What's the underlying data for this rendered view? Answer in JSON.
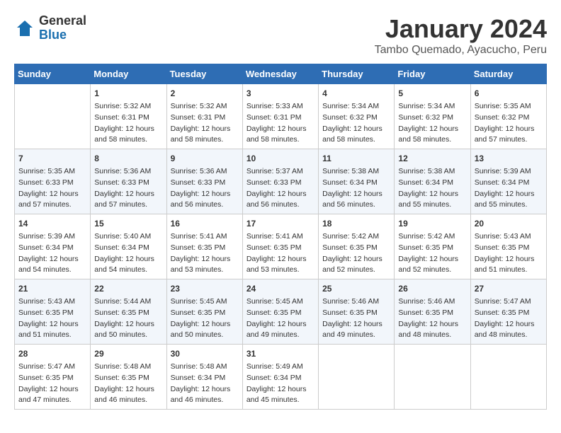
{
  "header": {
    "logo_general": "General",
    "logo_blue": "Blue",
    "month": "January 2024",
    "location": "Tambo Quemado, Ayacucho, Peru"
  },
  "days_of_week": [
    "Sunday",
    "Monday",
    "Tuesday",
    "Wednesday",
    "Thursday",
    "Friday",
    "Saturday"
  ],
  "weeks": [
    [
      {
        "day": "",
        "sunrise": "",
        "sunset": "",
        "daylight": ""
      },
      {
        "day": "1",
        "sunrise": "Sunrise: 5:32 AM",
        "sunset": "Sunset: 6:31 PM",
        "daylight": "Daylight: 12 hours and 58 minutes."
      },
      {
        "day": "2",
        "sunrise": "Sunrise: 5:32 AM",
        "sunset": "Sunset: 6:31 PM",
        "daylight": "Daylight: 12 hours and 58 minutes."
      },
      {
        "day": "3",
        "sunrise": "Sunrise: 5:33 AM",
        "sunset": "Sunset: 6:31 PM",
        "daylight": "Daylight: 12 hours and 58 minutes."
      },
      {
        "day": "4",
        "sunrise": "Sunrise: 5:34 AM",
        "sunset": "Sunset: 6:32 PM",
        "daylight": "Daylight: 12 hours and 58 minutes."
      },
      {
        "day": "5",
        "sunrise": "Sunrise: 5:34 AM",
        "sunset": "Sunset: 6:32 PM",
        "daylight": "Daylight: 12 hours and 58 minutes."
      },
      {
        "day": "6",
        "sunrise": "Sunrise: 5:35 AM",
        "sunset": "Sunset: 6:32 PM",
        "daylight": "Daylight: 12 hours and 57 minutes."
      }
    ],
    [
      {
        "day": "7",
        "sunrise": "Sunrise: 5:35 AM",
        "sunset": "Sunset: 6:33 PM",
        "daylight": "Daylight: 12 hours and 57 minutes."
      },
      {
        "day": "8",
        "sunrise": "Sunrise: 5:36 AM",
        "sunset": "Sunset: 6:33 PM",
        "daylight": "Daylight: 12 hours and 57 minutes."
      },
      {
        "day": "9",
        "sunrise": "Sunrise: 5:36 AM",
        "sunset": "Sunset: 6:33 PM",
        "daylight": "Daylight: 12 hours and 56 minutes."
      },
      {
        "day": "10",
        "sunrise": "Sunrise: 5:37 AM",
        "sunset": "Sunset: 6:33 PM",
        "daylight": "Daylight: 12 hours and 56 minutes."
      },
      {
        "day": "11",
        "sunrise": "Sunrise: 5:38 AM",
        "sunset": "Sunset: 6:34 PM",
        "daylight": "Daylight: 12 hours and 56 minutes."
      },
      {
        "day": "12",
        "sunrise": "Sunrise: 5:38 AM",
        "sunset": "Sunset: 6:34 PM",
        "daylight": "Daylight: 12 hours and 55 minutes."
      },
      {
        "day": "13",
        "sunrise": "Sunrise: 5:39 AM",
        "sunset": "Sunset: 6:34 PM",
        "daylight": "Daylight: 12 hours and 55 minutes."
      }
    ],
    [
      {
        "day": "14",
        "sunrise": "Sunrise: 5:39 AM",
        "sunset": "Sunset: 6:34 PM",
        "daylight": "Daylight: 12 hours and 54 minutes."
      },
      {
        "day": "15",
        "sunrise": "Sunrise: 5:40 AM",
        "sunset": "Sunset: 6:34 PM",
        "daylight": "Daylight: 12 hours and 54 minutes."
      },
      {
        "day": "16",
        "sunrise": "Sunrise: 5:41 AM",
        "sunset": "Sunset: 6:35 PM",
        "daylight": "Daylight: 12 hours and 53 minutes."
      },
      {
        "day": "17",
        "sunrise": "Sunrise: 5:41 AM",
        "sunset": "Sunset: 6:35 PM",
        "daylight": "Daylight: 12 hours and 53 minutes."
      },
      {
        "day": "18",
        "sunrise": "Sunrise: 5:42 AM",
        "sunset": "Sunset: 6:35 PM",
        "daylight": "Daylight: 12 hours and 52 minutes."
      },
      {
        "day": "19",
        "sunrise": "Sunrise: 5:42 AM",
        "sunset": "Sunset: 6:35 PM",
        "daylight": "Daylight: 12 hours and 52 minutes."
      },
      {
        "day": "20",
        "sunrise": "Sunrise: 5:43 AM",
        "sunset": "Sunset: 6:35 PM",
        "daylight": "Daylight: 12 hours and 51 minutes."
      }
    ],
    [
      {
        "day": "21",
        "sunrise": "Sunrise: 5:43 AM",
        "sunset": "Sunset: 6:35 PM",
        "daylight": "Daylight: 12 hours and 51 minutes."
      },
      {
        "day": "22",
        "sunrise": "Sunrise: 5:44 AM",
        "sunset": "Sunset: 6:35 PM",
        "daylight": "Daylight: 12 hours and 50 minutes."
      },
      {
        "day": "23",
        "sunrise": "Sunrise: 5:45 AM",
        "sunset": "Sunset: 6:35 PM",
        "daylight": "Daylight: 12 hours and 50 minutes."
      },
      {
        "day": "24",
        "sunrise": "Sunrise: 5:45 AM",
        "sunset": "Sunset: 6:35 PM",
        "daylight": "Daylight: 12 hours and 49 minutes."
      },
      {
        "day": "25",
        "sunrise": "Sunrise: 5:46 AM",
        "sunset": "Sunset: 6:35 PM",
        "daylight": "Daylight: 12 hours and 49 minutes."
      },
      {
        "day": "26",
        "sunrise": "Sunrise: 5:46 AM",
        "sunset": "Sunset: 6:35 PM",
        "daylight": "Daylight: 12 hours and 48 minutes."
      },
      {
        "day": "27",
        "sunrise": "Sunrise: 5:47 AM",
        "sunset": "Sunset: 6:35 PM",
        "daylight": "Daylight: 12 hours and 48 minutes."
      }
    ],
    [
      {
        "day": "28",
        "sunrise": "Sunrise: 5:47 AM",
        "sunset": "Sunset: 6:35 PM",
        "daylight": "Daylight: 12 hours and 47 minutes."
      },
      {
        "day": "29",
        "sunrise": "Sunrise: 5:48 AM",
        "sunset": "Sunset: 6:35 PM",
        "daylight": "Daylight: 12 hours and 46 minutes."
      },
      {
        "day": "30",
        "sunrise": "Sunrise: 5:48 AM",
        "sunset": "Sunset: 6:34 PM",
        "daylight": "Daylight: 12 hours and 46 minutes."
      },
      {
        "day": "31",
        "sunrise": "Sunrise: 5:49 AM",
        "sunset": "Sunset: 6:34 PM",
        "daylight": "Daylight: 12 hours and 45 minutes."
      },
      {
        "day": "",
        "sunrise": "",
        "sunset": "",
        "daylight": ""
      },
      {
        "day": "",
        "sunrise": "",
        "sunset": "",
        "daylight": ""
      },
      {
        "day": "",
        "sunrise": "",
        "sunset": "",
        "daylight": ""
      }
    ]
  ]
}
